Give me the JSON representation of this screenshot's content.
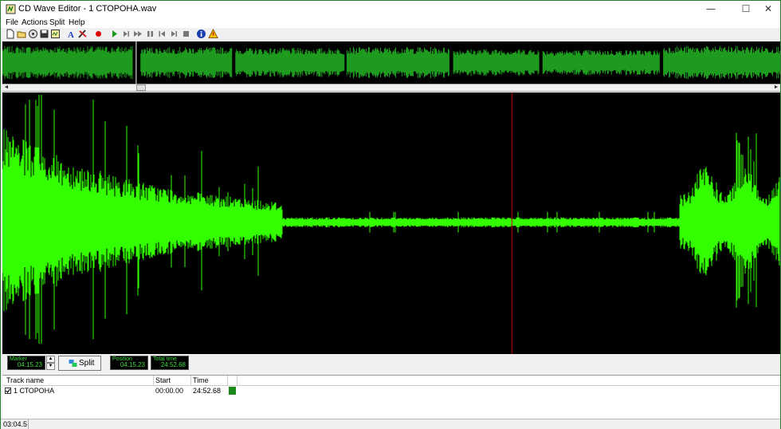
{
  "window": {
    "title": "CD Wave Editor - 1 СТОРОНА.wav",
    "minimize": "—",
    "maximize": "☐",
    "close": "✕"
  },
  "menu": [
    "File",
    "Actions",
    "Split",
    "Help"
  ],
  "toolbar": {
    "icons": [
      "new-icon",
      "open-icon",
      "cd-icon",
      "save-icon",
      "save-tracks-icon",
      "font-icon",
      "tools-icon",
      "record-icon",
      "play-icon",
      "play-to-end-icon",
      "fast-forward-icon",
      "pause-icon",
      "rewind-icon",
      "skip-forward-icon",
      "stop-icon",
      "info-icon",
      "warning-icon"
    ]
  },
  "scroll": {
    "left": "◄",
    "right": "►"
  },
  "controls": {
    "marker_label": "Marker",
    "marker_value": "04:15.23",
    "spin_up": "▲",
    "spin_down": "▼",
    "split_label": "Split",
    "position_label": "Position",
    "position_value": "04:15.23",
    "total_label": "Total time",
    "total_value": "24:52.68"
  },
  "tracks": {
    "columns": [
      "Track name",
      "Start",
      "Time"
    ],
    "rows": [
      {
        "name": "1 СТОРОНА",
        "start": "00:00.00",
        "time": "24:52.68",
        "checked": true,
        "color": "#1a8a1a"
      }
    ]
  },
  "status": {
    "time": "03:04.5"
  },
  "colors": {
    "wave": "#33ff00",
    "overview_wave": "#1e9b1e",
    "cursor": "#c00000"
  },
  "wave": {
    "overview_position": 0.172,
    "cursor_position": 0.655,
    "overview_sections": [
      {
        "start": 0.0,
        "end": 0.168,
        "level": 0.85
      },
      {
        "start": 0.178,
        "end": 0.295,
        "level": 0.8
      },
      {
        "start": 0.3,
        "end": 0.44,
        "level": 0.75
      },
      {
        "start": 0.443,
        "end": 0.575,
        "level": 0.8
      },
      {
        "start": 0.58,
        "end": 0.69,
        "level": 0.7
      },
      {
        "start": 0.695,
        "end": 0.845,
        "level": 0.65
      },
      {
        "start": 0.85,
        "end": 1.0,
        "level": 0.85
      }
    ]
  }
}
